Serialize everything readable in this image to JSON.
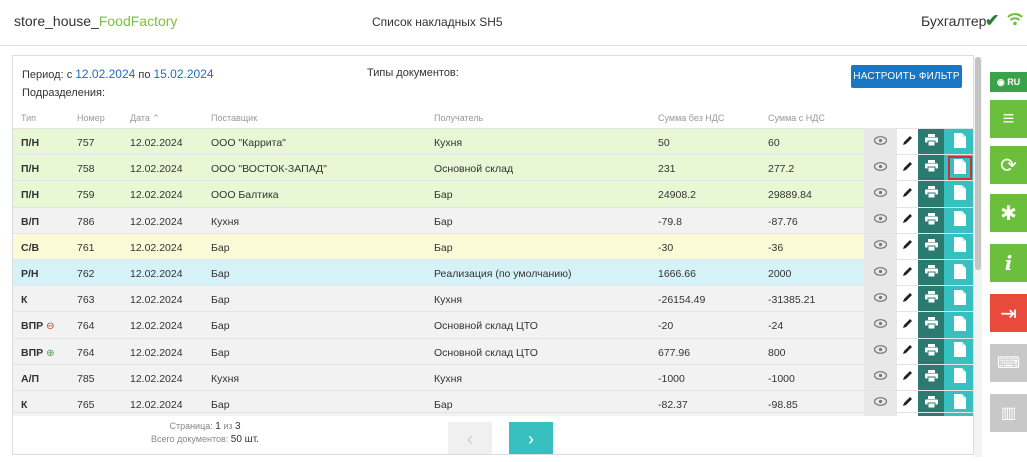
{
  "header": {
    "app_name_main": "store_house_",
    "app_name_accent": "FoodFactory",
    "doc_title": "Список накладных SH5",
    "user": "Бухгалтер"
  },
  "filter": {
    "period_prefix": "Период: с ",
    "date_from": "12.02.2024",
    "period_mid": " по ",
    "date_to": "15.02.2024",
    "divisions_label": "Подразделения:",
    "doc_types_label": "Типы документов:",
    "button_label": "НАСТРОИТЬ ФИЛЬТР"
  },
  "columns": {
    "type": "Тип",
    "number": "Номер",
    "date": "Дата ⌃",
    "supplier": "Поставщик",
    "receiver": "Получатель",
    "sum_no_vat": "Сумма без НДС",
    "sum_vat": "Сумма с НДС"
  },
  "rows": [
    {
      "type": "П/Н",
      "mark": "",
      "number": "757",
      "date": "12.02.2024",
      "supplier": "ООО \"Каррита\"",
      "receiver": "Кухня",
      "sum_no_vat": "50",
      "sum_vat": "60",
      "bg": "#e8f7d4"
    },
    {
      "type": "П/Н",
      "mark": "",
      "number": "758",
      "date": "12.02.2024",
      "supplier": "ООО \"ВОСТОК-ЗАПАД\"",
      "receiver": "Основной склад",
      "sum_no_vat": "231",
      "sum_vat": "277.2",
      "bg": "#e8f7d4"
    },
    {
      "type": "П/Н",
      "mark": "",
      "number": "759",
      "date": "12.02.2024",
      "supplier": "ООО Балтика",
      "receiver": "Бар",
      "sum_no_vat": "24908.2",
      "sum_vat": "29889.84",
      "bg": "#e8f7d4"
    },
    {
      "type": "В/П",
      "mark": "",
      "number": "786",
      "date": "12.02.2024",
      "supplier": "Кухня",
      "receiver": "Бар",
      "sum_no_vat": "-79.8",
      "sum_vat": "-87.76",
      "bg": "#f2f2f2"
    },
    {
      "type": "С/В",
      "mark": "",
      "number": "761",
      "date": "12.02.2024",
      "supplier": "Бар",
      "receiver": "Бар",
      "sum_no_vat": "-30",
      "sum_vat": "-36",
      "bg": "#fbfbd8"
    },
    {
      "type": "Р/Н",
      "mark": "",
      "number": "762",
      "date": "12.02.2024",
      "supplier": "Бар",
      "receiver": "Реализация (по умолчанию)",
      "sum_no_vat": "1666.66",
      "sum_vat": "2000",
      "bg": "#d5f2f8"
    },
    {
      "type": "К",
      "mark": "",
      "number": "763",
      "date": "12.02.2024",
      "supplier": "Бар",
      "receiver": "Кухня",
      "sum_no_vat": "-26154.49",
      "sum_vat": "-31385.21",
      "bg": "#f2f2f2"
    },
    {
      "type": "ВПР",
      "mark": "⊖",
      "mark_color": "#d32f2f",
      "number": "764",
      "date": "12.02.2024",
      "supplier": "Бар",
      "receiver": "Основной склад ЦТО",
      "sum_no_vat": "-20",
      "sum_vat": "-24",
      "bg": "#f2f2f2"
    },
    {
      "type": "ВПР",
      "mark": "⊕",
      "mark_color": "#43a047",
      "number": "764",
      "date": "12.02.2024",
      "supplier": "Бар",
      "receiver": "Основной склад ЦТО",
      "sum_no_vat": "677.96",
      "sum_vat": "800",
      "bg": "#f2f2f2"
    },
    {
      "type": "А/П",
      "mark": "",
      "number": "785",
      "date": "12.02.2024",
      "supplier": "Кухня",
      "receiver": "Кухня",
      "sum_no_vat": "-1000",
      "sum_vat": "-1000",
      "bg": "#f2f2f2"
    },
    {
      "type": "К",
      "mark": "",
      "number": "765",
      "date": "12.02.2024",
      "supplier": "Бар",
      "receiver": "Бар",
      "sum_no_vat": "-82.37",
      "sum_vat": "-98.85",
      "bg": "#f2f2f2"
    }
  ],
  "highlighted_row": 1,
  "pager": {
    "page_prefix": "Страница: ",
    "page_current": "1",
    "page_mid": " из ",
    "page_total": "3",
    "total_prefix": "Всего документов: ",
    "total_count": "50 шт."
  },
  "sidebar": {
    "lang": "RU"
  },
  "icons": [
    "check-icon",
    "wifi-icon",
    "eye-icon",
    "pencil-icon",
    "print-icon",
    "file-icon",
    "globe-icon",
    "menu-icon",
    "sync-icon",
    "gear-icon",
    "info-icon",
    "exit-icon",
    "keyboard-icon",
    "barcode-icon",
    "chevron-left-icon",
    "chevron-right-icon"
  ]
}
